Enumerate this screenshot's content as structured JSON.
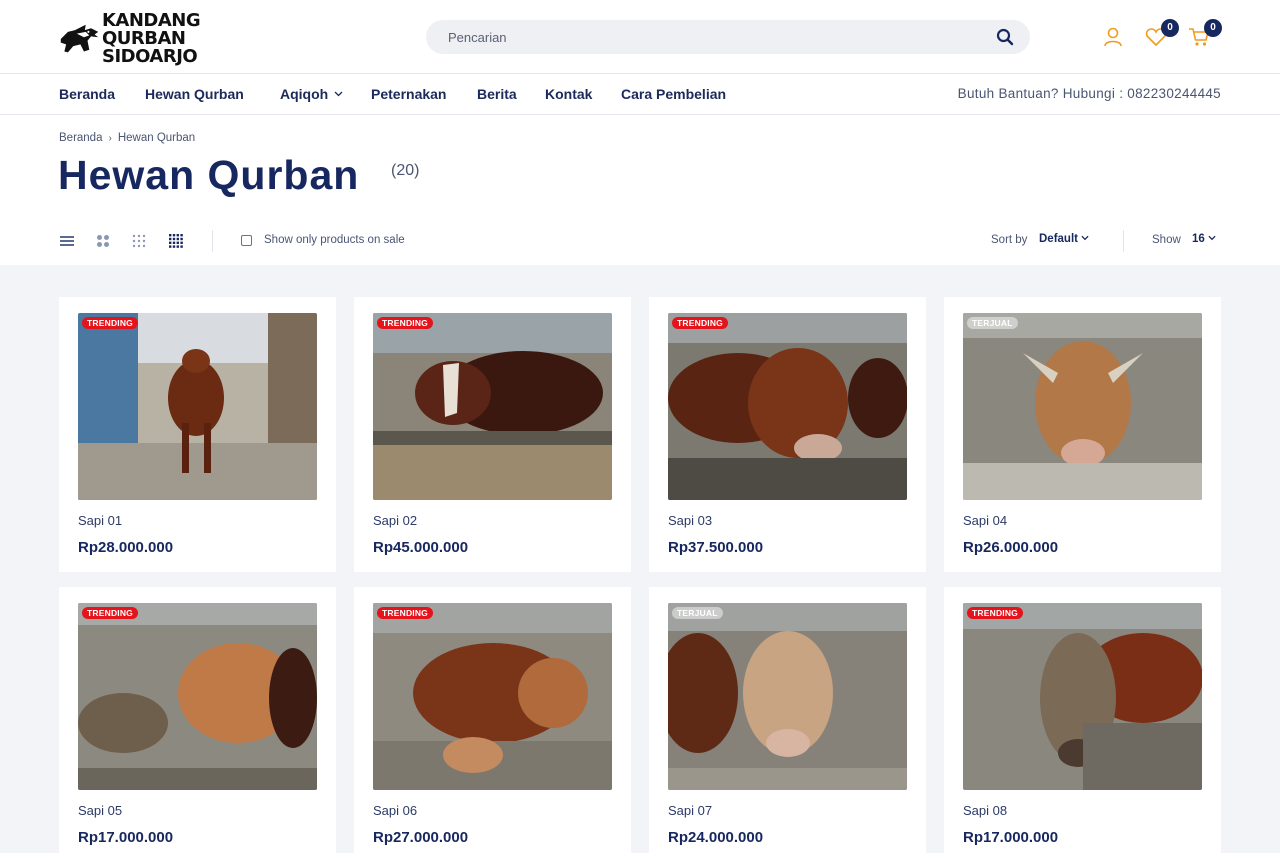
{
  "brand": {
    "line1": "KANDANG QURBAN",
    "line2": "SIDOARJO"
  },
  "search": {
    "placeholder": "Pencarian",
    "icon": "search-icon"
  },
  "header_icons": {
    "account": "user-icon",
    "wishlist_count": "0",
    "cart_count": "0"
  },
  "nav": {
    "items": [
      "Beranda",
      "Hewan Qurban",
      "Aqiqoh",
      "Peternakan",
      "Berita",
      "Kontak",
      "Cara Pembelian"
    ],
    "help": "Butuh Bantuan? Hubungi : 082230244445"
  },
  "breadcrumb": {
    "home": "Beranda",
    "current": "Hewan Qurban"
  },
  "page": {
    "title": "Hewan Qurban",
    "count": "(20)"
  },
  "toolbar": {
    "sale_only_label": "Show only products on sale",
    "sort_label": "Sort by",
    "sort_value": "Default",
    "show_label": "Show",
    "show_value": "16"
  },
  "colors": {
    "accent": "#17275f",
    "trending": "#e3141b",
    "icon_orange": "#f39a1d"
  },
  "products": [
    {
      "name": "Sapi 01",
      "price": "Rp28.000.000",
      "tag": "TRENDING"
    },
    {
      "name": "Sapi 02",
      "price": "Rp45.000.000",
      "tag": "TRENDING"
    },
    {
      "name": "Sapi 03",
      "price": "Rp37.500.000",
      "tag": "TRENDING"
    },
    {
      "name": "Sapi 04",
      "price": "Rp26.000.000",
      "tag": "TERJUAL"
    },
    {
      "name": "Sapi 05",
      "price": "Rp17.000.000",
      "tag": "TRENDING"
    },
    {
      "name": "Sapi 06",
      "price": "Rp27.000.000",
      "tag": "TRENDING"
    },
    {
      "name": "Sapi 07",
      "price": "Rp24.000.000",
      "tag": "TERJUAL"
    },
    {
      "name": "Sapi 08",
      "price": "Rp17.000.000",
      "tag": "TRENDING"
    }
  ]
}
